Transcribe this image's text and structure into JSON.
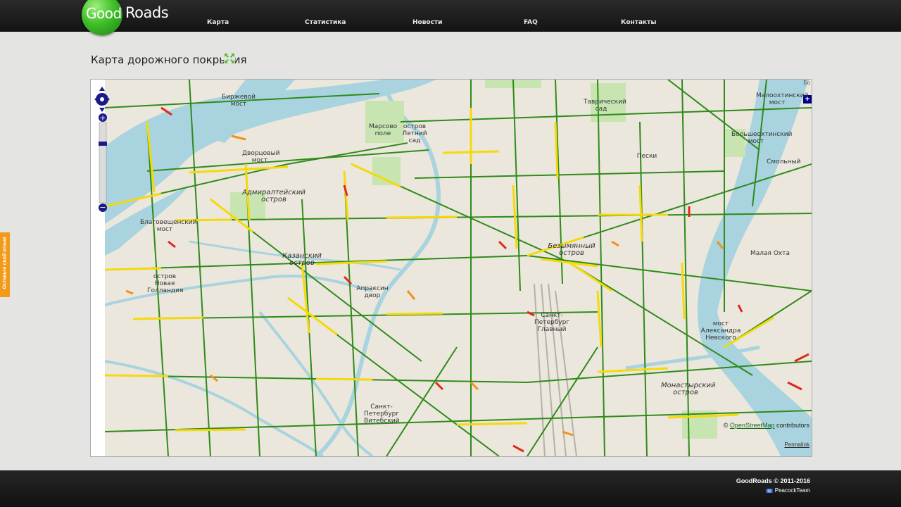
{
  "brand": {
    "good": "Good",
    "roads": "Roads"
  },
  "nav": [
    {
      "label": "Карта"
    },
    {
      "label": "Статистика"
    },
    {
      "label": "Новости"
    },
    {
      "label": "FAQ"
    },
    {
      "label": "Контакты"
    }
  ],
  "page": {
    "title": "Карта дорожного покрытия"
  },
  "map": {
    "attribution_prefix": "© ",
    "attribution_link": "OpenStreetMap",
    "attribution_suffix": " contributors",
    "permalink": "Permalink",
    "edge_label": "Бо",
    "labels": [
      {
        "text": "Биржевой мост"
      },
      {
        "text": "Марсово поле"
      },
      {
        "text": "остров Летний сад"
      },
      {
        "text": "Таврический сад"
      },
      {
        "text": "Малоохтинский мост"
      },
      {
        "text": "Большеохтинский мост"
      },
      {
        "text": "Смольный"
      },
      {
        "text": "Пески"
      },
      {
        "text": "Дворцовый мост"
      },
      {
        "text": "Адмиралтейский остров"
      },
      {
        "text": "Благовещенский мост"
      },
      {
        "text": "Казанский остров"
      },
      {
        "text": "Безымянный остров"
      },
      {
        "text": "Малая Охта"
      },
      {
        "text": "остров Новая Голландия"
      },
      {
        "text": "мост Александра Невского"
      },
      {
        "text": "Монастырский остров"
      },
      {
        "text": "Санкт-Петербург Главный"
      },
      {
        "text": "Санкт-Петербург Витебский"
      },
      {
        "text": "Апраксин двор"
      }
    ]
  },
  "feedback": {
    "label": "Оставьте свой отзыв"
  },
  "footer": {
    "copyright": "GoodRoads © 2011-2016",
    "team": "PeacockTeam"
  },
  "colors": {
    "good": "#2e8b1a",
    "medium": "#f5d90a",
    "bad": "#e0281a",
    "water": "#a9d3de",
    "land": "#ece7dd",
    "park": "#c8e5b1"
  }
}
